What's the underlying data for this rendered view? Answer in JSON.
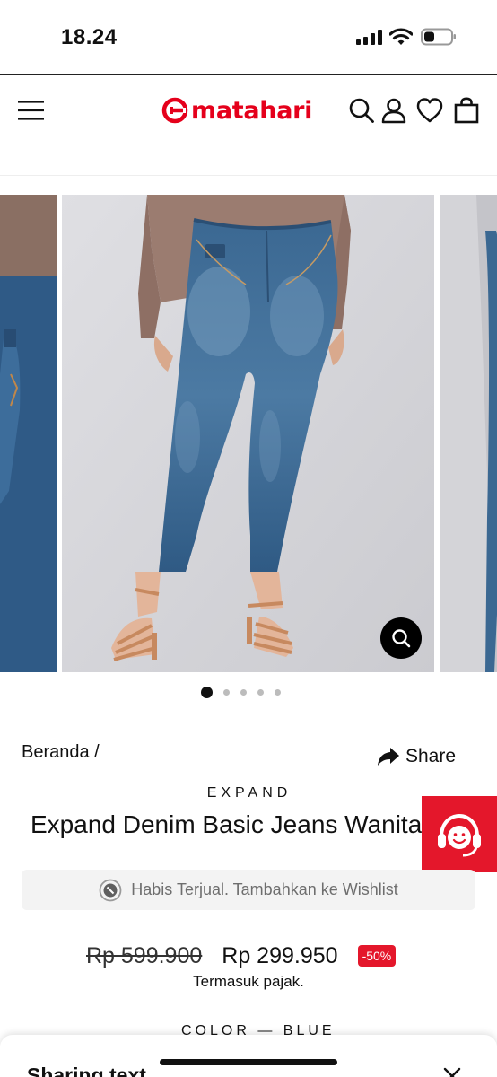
{
  "status_bar": {
    "time": "18.24"
  },
  "header": {
    "logo_text": "matahari",
    "brand_color": "#e5001b",
    "icons": [
      "menu-icon",
      "search-icon",
      "account-icon",
      "heart-icon",
      "shopping-bag-icon"
    ]
  },
  "carousel": {
    "slides": 5,
    "active_index": 0,
    "zoom_icon": "magnifier-icon"
  },
  "product": {
    "breadcrumb": "Beranda /",
    "share_label": "Share",
    "brand": "EXPAND",
    "name": "Expand Denim Basic Jeans Wanita",
    "soldout_message": "Habis Terjual. Tambahkan ke Wishlist",
    "old_price": "Rp 599.900",
    "new_price": "Rp 299.950",
    "discount": "-50%",
    "tax_note": "Termasuk pajak.",
    "color_label": "COLOR — BLUE",
    "accent_color": "#e4172b"
  },
  "sheet": {
    "title": "Sharing text",
    "close_icon": "close-icon"
  }
}
